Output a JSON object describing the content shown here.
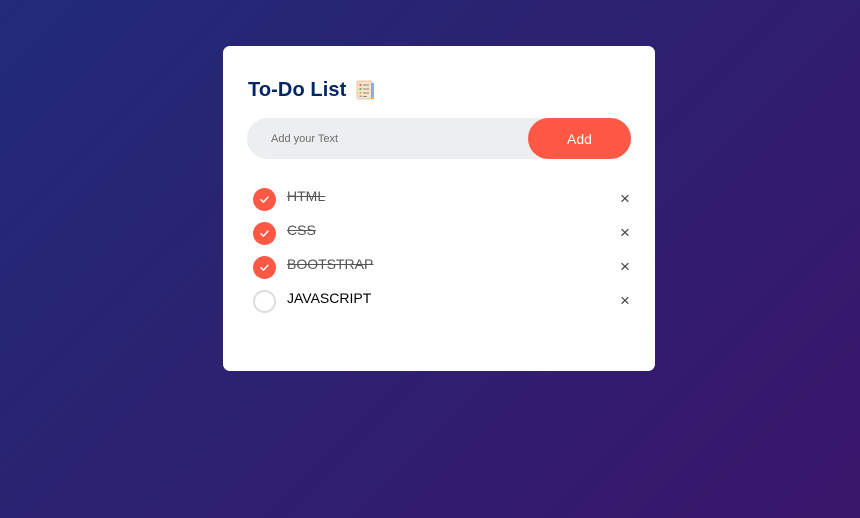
{
  "app": {
    "title": "To-Do List",
    "title_icon": "checklist-notepad-icon"
  },
  "input": {
    "placeholder": "Add your Text",
    "value": "",
    "add_label": "Add"
  },
  "colors": {
    "accent": "#ff5945",
    "title": "#002765",
    "input_bg": "#edeef0",
    "bg_start": "#212b7a",
    "bg_end": "#3a166b"
  },
  "todos": [
    {
      "text": "HTML",
      "checked": true,
      "delete_label": "×"
    },
    {
      "text": "CSS",
      "checked": true,
      "delete_label": "×"
    },
    {
      "text": "BOOTSTRAP",
      "checked": true,
      "delete_label": "×"
    },
    {
      "text": "JAVASCRIPT",
      "checked": false,
      "delete_label": "×"
    }
  ]
}
